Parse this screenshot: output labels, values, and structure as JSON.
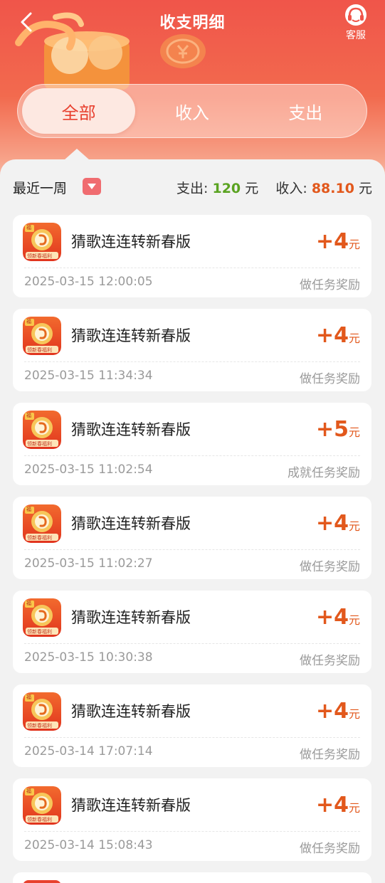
{
  "header": {
    "title": "收支明细",
    "back_icon": "chevron-left-icon",
    "service_label": "客服",
    "service_icon": "headset-icon"
  },
  "tabs": [
    {
      "label": "全部",
      "active": true
    },
    {
      "label": "收入",
      "active": false
    },
    {
      "label": "支出",
      "active": false
    }
  ],
  "summary": {
    "period": "最近一周",
    "expense_label": "支出:",
    "expense_value": "120",
    "expense_unit": "元",
    "income_label": "收入:",
    "income_value": "88.10",
    "income_unit": "元"
  },
  "colors": {
    "accent": "#e8402f",
    "income": "#e2581c",
    "expense": "#5aa321"
  },
  "records": [
    {
      "name": "猜歌连连转新春版",
      "amount": "+4",
      "unit": "元",
      "time": "2025-03-15 12:00:05",
      "reason": "做任务奖励",
      "icon_badge": "福",
      "icon_banner": "领新春福利"
    },
    {
      "name": "猜歌连连转新春版",
      "amount": "+4",
      "unit": "元",
      "time": "2025-03-15 11:34:34",
      "reason": "做任务奖励",
      "icon_badge": "福",
      "icon_banner": "领新春福利"
    },
    {
      "name": "猜歌连连转新春版",
      "amount": "+5",
      "unit": "元",
      "time": "2025-03-15 11:02:54",
      "reason": "成就任务奖励",
      "icon_badge": "福",
      "icon_banner": "领新春福利"
    },
    {
      "name": "猜歌连连转新春版",
      "amount": "+4",
      "unit": "元",
      "time": "2025-03-15 11:02:27",
      "reason": "做任务奖励",
      "icon_badge": "福",
      "icon_banner": "领新春福利"
    },
    {
      "name": "猜歌连连转新春版",
      "amount": "+4",
      "unit": "元",
      "time": "2025-03-15 10:30:38",
      "reason": "做任务奖励",
      "icon_badge": "福",
      "icon_banner": "领新春福利"
    },
    {
      "name": "猜歌连连转新春版",
      "amount": "+4",
      "unit": "元",
      "time": "2025-03-14 17:07:14",
      "reason": "做任务奖励",
      "icon_badge": "福",
      "icon_banner": "领新春福利"
    },
    {
      "name": "猜歌连连转新春版",
      "amount": "+4",
      "unit": "元",
      "time": "2025-03-14 15:08:43",
      "reason": "做任务奖励",
      "icon_badge": "福",
      "icon_banner": "领新春福利"
    }
  ]
}
